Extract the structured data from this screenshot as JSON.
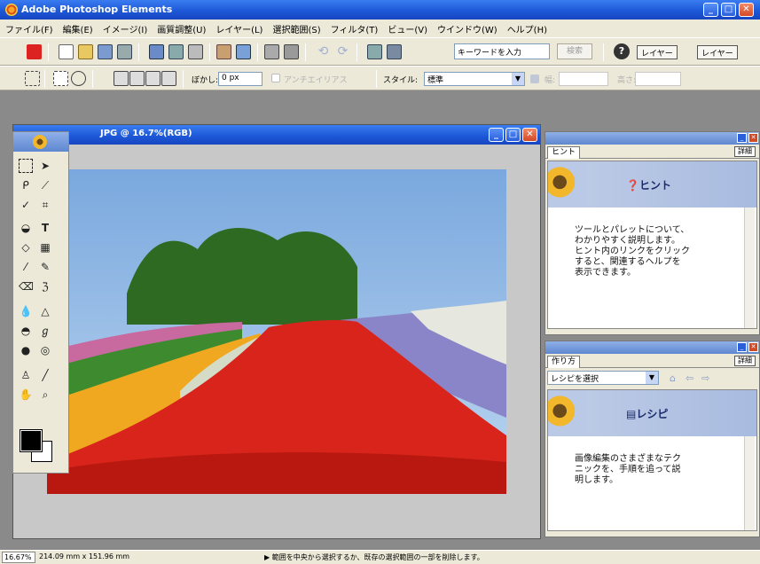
{
  "window": {
    "title": "Adobe Photoshop Elements",
    "min_glyph": "_",
    "max_glyph": "□",
    "close_glyph": "✕"
  },
  "menu": [
    "ファイル(F)",
    "編集(E)",
    "イメージ(I)",
    "画質調整(U)",
    "レイヤー(L)",
    "選択範囲(S)",
    "フィルタ(T)",
    "ビュー(V)",
    "ウインドウ(W)",
    "ヘルプ(H)"
  ],
  "toolbar": {
    "keyword_placeholder": "キーワードを入力",
    "search_label": "検索",
    "help_glyph": "?",
    "layer_tab_1": "レイヤー",
    "layer_tab_2": "レイヤー"
  },
  "options": {
    "feather_label": "ぼかし:",
    "feather_value": "0 px",
    "antialias_label": "アンチエイリアス",
    "style_label": "スタイル:",
    "style_value": "標準",
    "width_label": "幅:",
    "height_label": "高さ:"
  },
  "document": {
    "title": "JPG @ 16.7%(RGB)"
  },
  "hint_palette": {
    "tab": "ヒント",
    "more": "詳細",
    "heading": "ヒント",
    "text": "ツールとパレットについて、\nわかりやすく説明します。\nヒント内のリンクをクリック\nすると、関連するヘルプを\n表示できます。"
  },
  "recipe_palette": {
    "tab": "作り方",
    "more": "詳細",
    "select": "レシピを選択",
    "heading": "レシピ",
    "text": "画像編集のさまざまなテク\nニックを、手順を追って説\n明します。"
  },
  "status": {
    "zoom": "16.67%",
    "dimensions": "214.09 mm x 151.96 mm",
    "hint": "▶ 範囲を中央から選択するか、既存の選択範囲の一部を削除します。"
  },
  "colors": {
    "titlebar": "#1b56d6",
    "chrome": "#ece9d8",
    "workspace": "#8a8a8a"
  }
}
